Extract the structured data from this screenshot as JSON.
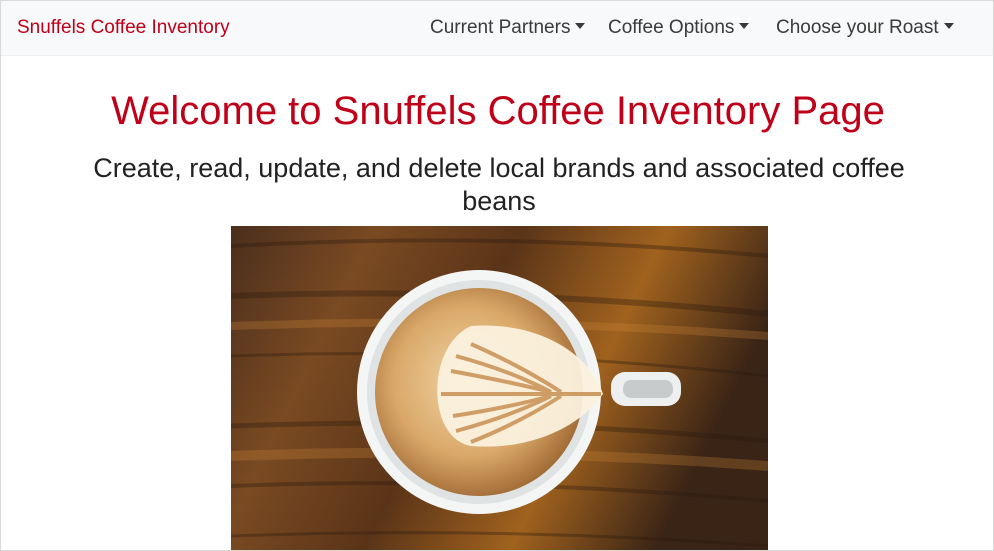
{
  "navbar": {
    "brand": "Snuffels Coffee Inventory",
    "items": [
      {
        "label": "Current Partners"
      },
      {
        "label": "Coffee Options"
      },
      {
        "label": "Choose your Roast"
      }
    ]
  },
  "main": {
    "headline": "Welcome to Snuffels Coffee Inventory Page",
    "subheadline": "Create, read, update, and delete local brands and associated coffee beans"
  },
  "colors": {
    "brand": "#c00018",
    "nav_text": "#3a3a3a",
    "navbar_bg": "#f8f9fa"
  }
}
